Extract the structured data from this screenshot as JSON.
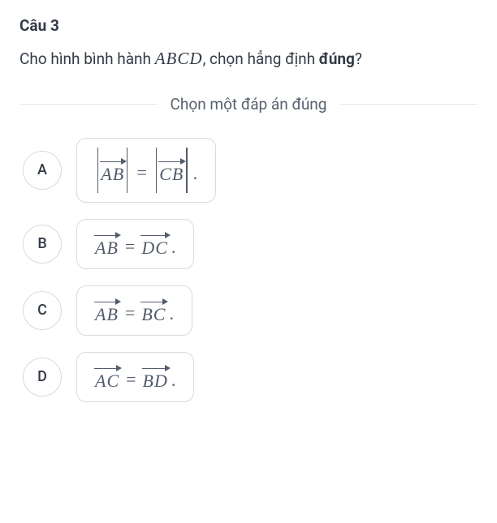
{
  "question": {
    "number_label": "Câu 3",
    "prompt_pre": "Cho hình bình hành ",
    "prompt_expr": "ABCD",
    "prompt_post": ", chọn hẳng định ",
    "prompt_bold": "đúng",
    "prompt_end": "?",
    "instruction": "Chọn một đáp án đúng"
  },
  "options": {
    "a": {
      "letter": "A",
      "lhs": "AB",
      "rhs": "CB",
      "op": "=",
      "magnitude": true
    },
    "b": {
      "letter": "B",
      "lhs": "AB",
      "rhs": "DC",
      "op": "=",
      "magnitude": false
    },
    "c": {
      "letter": "C",
      "lhs": "AB",
      "rhs": "BC",
      "op": "=",
      "magnitude": false
    },
    "d": {
      "letter": "D",
      "lhs": "AC",
      "rhs": "BD",
      "op": "=",
      "magnitude": false
    }
  }
}
